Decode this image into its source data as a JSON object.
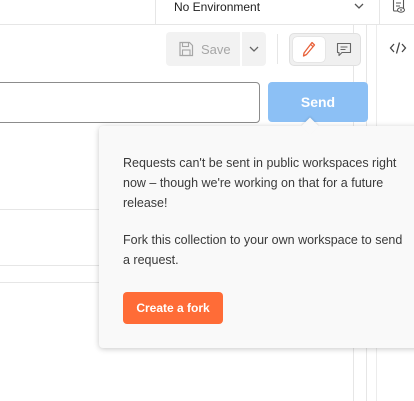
{
  "environment": {
    "selected": "No Environment",
    "icons": {
      "chevron": "chevron-down-icon",
      "environment": "environment-quick-look-icon"
    }
  },
  "toolbar": {
    "save_label": "Save",
    "icons": {
      "save": "save-icon",
      "caret": "chevron-down-icon",
      "edit": "pencil-icon",
      "comment": "comment-icon"
    }
  },
  "right_panel": {
    "icons": {
      "code": "code-icon"
    }
  },
  "request": {
    "url_value": "",
    "send_label": "Send"
  },
  "popover": {
    "message": "Requests can't be sent in public workspaces right now – though we're working on that for a future release!",
    "instruction": "Fork this collection to your own workspace to send a request.",
    "fork_button_label": "Create a fork"
  },
  "colors": {
    "send_disabled": "#8cc0f5",
    "fork_accent": "#ff6c37",
    "edit_icon": "#e8613a"
  }
}
